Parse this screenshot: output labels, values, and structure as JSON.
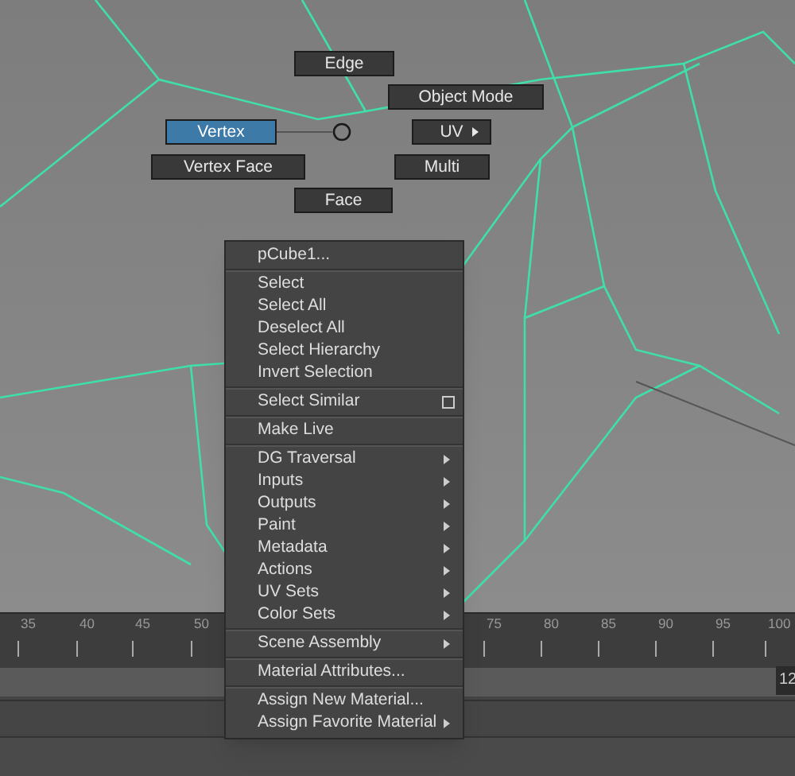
{
  "marking_menu": {
    "items": [
      {
        "label": "Edge",
        "selected": false,
        "submenu": false
      },
      {
        "label": "Object Mode",
        "selected": false,
        "submenu": false
      },
      {
        "label": "Vertex",
        "selected": true,
        "submenu": false
      },
      {
        "label": "UV",
        "selected": false,
        "submenu": true
      },
      {
        "label": "Vertex Face",
        "selected": false,
        "submenu": false
      },
      {
        "label": "Multi",
        "selected": false,
        "submenu": false
      },
      {
        "label": "Face",
        "selected": false,
        "submenu": false
      }
    ]
  },
  "context_menu": {
    "items": [
      {
        "kind": "header",
        "label": "pCube1..."
      },
      {
        "kind": "separator"
      },
      {
        "kind": "item",
        "label": "Select",
        "submenu": false,
        "option_box": false
      },
      {
        "kind": "item",
        "label": "Select All",
        "submenu": false,
        "option_box": false
      },
      {
        "kind": "item",
        "label": "Deselect All",
        "submenu": false,
        "option_box": false
      },
      {
        "kind": "item",
        "label": "Select Hierarchy",
        "submenu": false,
        "option_box": false
      },
      {
        "kind": "item",
        "label": "Invert Selection",
        "submenu": false,
        "option_box": false
      },
      {
        "kind": "separator"
      },
      {
        "kind": "item",
        "label": "Select Similar",
        "submenu": false,
        "option_box": true
      },
      {
        "kind": "separator"
      },
      {
        "kind": "item",
        "label": "Make Live",
        "submenu": false,
        "option_box": false
      },
      {
        "kind": "separator"
      },
      {
        "kind": "item",
        "label": "DG Traversal",
        "submenu": true,
        "option_box": false
      },
      {
        "kind": "item",
        "label": "Inputs",
        "submenu": true,
        "option_box": false
      },
      {
        "kind": "item",
        "label": "Outputs",
        "submenu": true,
        "option_box": false
      },
      {
        "kind": "item",
        "label": "Paint",
        "submenu": true,
        "option_box": false
      },
      {
        "kind": "item",
        "label": "Metadata",
        "submenu": true,
        "option_box": false
      },
      {
        "kind": "item",
        "label": "Actions",
        "submenu": true,
        "option_box": false
      },
      {
        "kind": "item",
        "label": "UV Sets",
        "submenu": true,
        "option_box": false
      },
      {
        "kind": "item",
        "label": "Color Sets",
        "submenu": true,
        "option_box": false
      },
      {
        "kind": "separator"
      },
      {
        "kind": "item",
        "label": "Scene Assembly",
        "submenu": true,
        "option_box": false
      },
      {
        "kind": "separator"
      },
      {
        "kind": "item",
        "label": "Material Attributes...",
        "submenu": false,
        "option_box": false
      },
      {
        "kind": "separator"
      },
      {
        "kind": "item",
        "label": "Assign New Material...",
        "submenu": false,
        "option_box": false
      },
      {
        "kind": "item",
        "label": "Assign Favorite Material",
        "submenu": true,
        "option_box": false
      }
    ]
  },
  "timeline": {
    "ticks": [
      "35",
      "40",
      "45",
      "50",
      "75",
      "80",
      "85",
      "90",
      "95",
      "100"
    ]
  },
  "frame_field": {
    "value": "12"
  }
}
